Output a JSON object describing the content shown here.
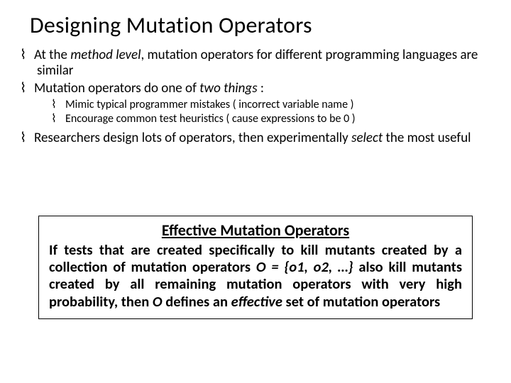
{
  "title": "Designing Mutation Operators",
  "bullets": {
    "b1a": "At the ",
    "b1b": "method level",
    "b1c": ", mutation operators for different programming languages are similar",
    "b2a": "Mutation operators do one of ",
    "b2b": "two things",
    "b2c": " :",
    "s1": "Mimic typical programmer mistakes ( incorrect variable name )",
    "s2": "Encourage common test heuristics ( cause expressions to be 0 )",
    "b3a": "Researchers design lots of operators, then experimentally ",
    "b3b": "select",
    "b3c": " the most useful"
  },
  "box": {
    "title": "Effective Mutation Operators",
    "p1": "If tests that are created specifically to kill mutants created by a collection of mutation operators ",
    "p2": "O = {o1, o2, …}",
    "p3": "  also kill mutants created by all remaining mutation operators with very high probability, then ",
    "p4": "O",
    "p5": " defines an ",
    "p6": "effective",
    "p7": " set of mutation operators"
  }
}
